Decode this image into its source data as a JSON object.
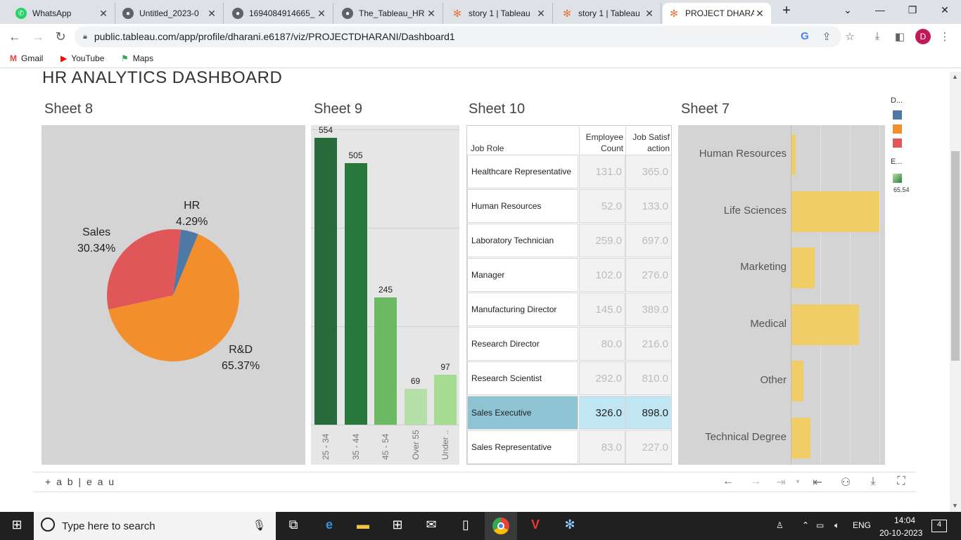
{
  "browser": {
    "tabs": [
      {
        "title": "WhatsApp",
        "color": "#25d366"
      },
      {
        "title": "Untitled_2023-0",
        "color": "#5f6368"
      },
      {
        "title": "1694084914665_",
        "color": "#5f6368"
      },
      {
        "title": "The_Tableau_HR",
        "color": "#5f6368"
      },
      {
        "title": "story 1 | Tableau",
        "color": "#e8743b"
      },
      {
        "title": "story 1 | Tableau",
        "color": "#e8743b"
      },
      {
        "title": "PROJECT DHARA",
        "color": "#e8743b"
      }
    ],
    "new_tab_label": "+",
    "url": "public.tableau.com/app/profile/dharani.e6187/viz/PROJECTDHARANI/Dashboard1",
    "profile_initial": "D",
    "bookmarks": [
      {
        "label": "Gmail"
      },
      {
        "label": "YouTube"
      },
      {
        "label": "Maps"
      }
    ]
  },
  "dashboard": {
    "title": "HR ANALYTICS DASHBOARD",
    "sheets": {
      "pie_title": "Sheet 8",
      "age_title": "Sheet 9",
      "table_title": "Sheet 10",
      "field_title": "Sheet 7"
    }
  },
  "chart_data": [
    {
      "type": "pie",
      "title": "Sheet 8",
      "slices": [
        {
          "label": "HR",
          "percent_label": "4.29%",
          "value": 4.29,
          "color": "#4e79a7"
        },
        {
          "label": "R&D",
          "percent_label": "65.37%",
          "value": 65.37,
          "color": "#f28e2b"
        },
        {
          "label": "Sales",
          "percent_label": "30.34%",
          "value": 30.34,
          "color": "#e15759"
        }
      ]
    },
    {
      "type": "bar",
      "title": "Sheet 9",
      "categories": [
        "25 - 34",
        "35 - 44",
        "45 - 54",
        "Over 55",
        "Under .."
      ],
      "values": [
        554,
        505,
        245,
        69,
        97
      ],
      "colors": [
        "#276b3a",
        "#28783d",
        "#6dba65",
        "#b5e0a7",
        "#a6dc91"
      ],
      "ylim": [
        0,
        570
      ]
    },
    {
      "type": "table",
      "title": "Sheet 10",
      "columns": [
        "Job Role",
        "Employee Count",
        "Job Satisfaction"
      ],
      "column_labels": {
        "role": "Job Role",
        "count_line1": "Employee",
        "count_line2": "Count",
        "sat_line1": "Job Satisf",
        "sat_line2": "action"
      },
      "rows": [
        {
          "role": "Healthcare Representative",
          "count": "131.0",
          "sat": "365.0"
        },
        {
          "role": "Human Resources",
          "count": "52.0",
          "sat": "133.0"
        },
        {
          "role": "Laboratory Technician",
          "count": "259.0",
          "sat": "697.0"
        },
        {
          "role": "Manager",
          "count": "102.0",
          "sat": "276.0"
        },
        {
          "role": "Manufacturing Director",
          "count": "145.0",
          "sat": "389.0"
        },
        {
          "role": "Research Director",
          "count": "80.0",
          "sat": "216.0"
        },
        {
          "role": "Research Scientist",
          "count": "292.0",
          "sat": "810.0"
        },
        {
          "role": "Sales Executive",
          "count": "326.0",
          "sat": "898.0",
          "highlight": true
        },
        {
          "role": "Sales Representative",
          "count": "83.0",
          "sat": "227.0"
        }
      ]
    },
    {
      "type": "bar",
      "title": "Sheet 7",
      "orientation": "horizontal",
      "categories": [
        "Human Resources",
        "Life Sciences",
        "Marketing",
        "Medical",
        "Other",
        "Technical Degree"
      ],
      "values": [
        27,
        606,
        159,
        464,
        82,
        132
      ],
      "xlim": [
        0,
        610
      ],
      "color": "#f0cd66"
    }
  ],
  "legend": {
    "title1": "D...",
    "title2": "E...",
    "colors": [
      "#4e79a7",
      "#f28e2b",
      "#e15759"
    ],
    "range_label": "65.54"
  },
  "tableau_footer": {
    "logo": "+ a b | e a u"
  },
  "taskbar": {
    "search_placeholder": "Type here to search",
    "lang": "ENG",
    "time": "14:04",
    "date": "20-10-2023",
    "notifications": "4"
  }
}
